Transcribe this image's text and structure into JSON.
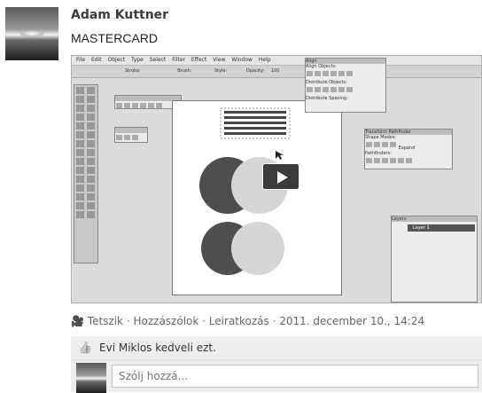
{
  "post": {
    "author": "Adam Kuttner",
    "message": "MASTERCARD"
  },
  "video": {
    "menu": [
      "File",
      "Edit",
      "Object",
      "Type",
      "Select",
      "Filter",
      "Effect",
      "View",
      "Window",
      "Help"
    ],
    "control": [
      "Stroke:",
      "Brush:",
      "Style:",
      "Opacity:",
      "100"
    ],
    "panels": {
      "align": "Align",
      "align_objects": "Align Objects:",
      "distribute_objects": "Distribute Objects:",
      "distribute_spacing": "Distribute Spacing:",
      "align_to": "Align To:",
      "transform": "Transform",
      "pathfinder": "Pathfinder",
      "shape_modes": "Shape Modes:",
      "pathfinders": "Pathfinders:",
      "expand": "Expand",
      "layers": "Layers",
      "layer1": "Layer 1"
    },
    "play_icon": "play-icon"
  },
  "footer": {
    "like": "Tetszik",
    "comments": "Hozzászólok",
    "unsubscribe": "Leiratkozás",
    "sep": "·",
    "timestamp": "2011. december 10., 14:24",
    "liker": "Evi Miklos",
    "likes_text": "kedveli ezt."
  },
  "comment": {
    "placeholder": "Szólj hozzá..."
  }
}
